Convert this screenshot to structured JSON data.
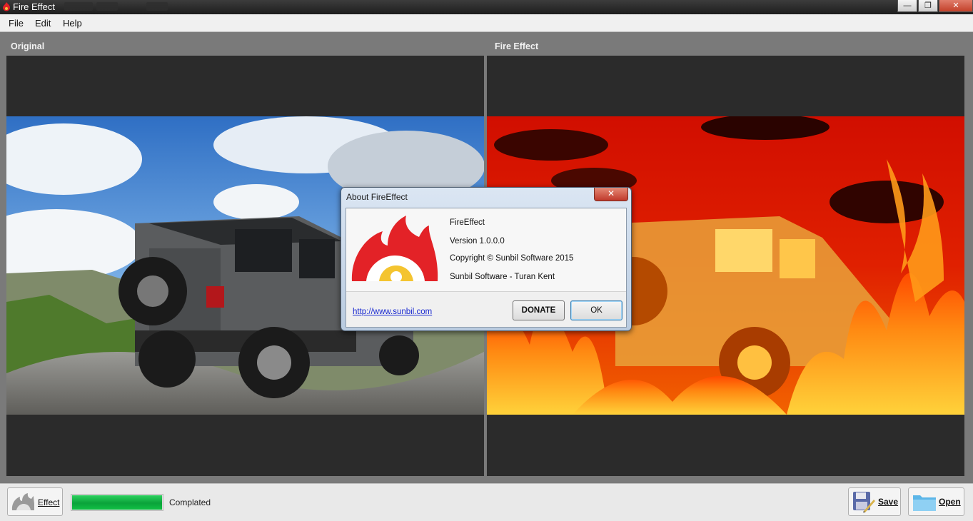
{
  "window": {
    "title": "Fire Effect"
  },
  "window_buttons": {
    "minimize": "—",
    "restore": "❐",
    "close": "✕"
  },
  "menu": {
    "items": [
      "File",
      "Edit",
      "Help"
    ]
  },
  "panels": {
    "original_label": "Original",
    "effect_label": "Fire Effect"
  },
  "about_dialog": {
    "title": "About FireEffect",
    "close_glyph": "✕",
    "product": "FireEffect",
    "version": "Version 1.0.0.0",
    "copyright": "Copyright © Sunbil Software 2015",
    "authors": "Sunbil Software - Turan Kent",
    "link": "http://www.sunbil.com",
    "donate_label": "DONATE",
    "ok_label": "OK"
  },
  "bottom": {
    "effect_label": "Effect",
    "progress": 1.0,
    "status": "Complated",
    "save_label": "Save",
    "open_label": "Open"
  },
  "colors": {
    "progress_green": "#10c044",
    "logo_red": "#e32227",
    "link_blue": "#1a2ad0"
  },
  "icons": [
    "fire-app-icon",
    "fire-logo-icon",
    "effect-icon",
    "save-disk-icon",
    "open-folder-icon"
  ]
}
